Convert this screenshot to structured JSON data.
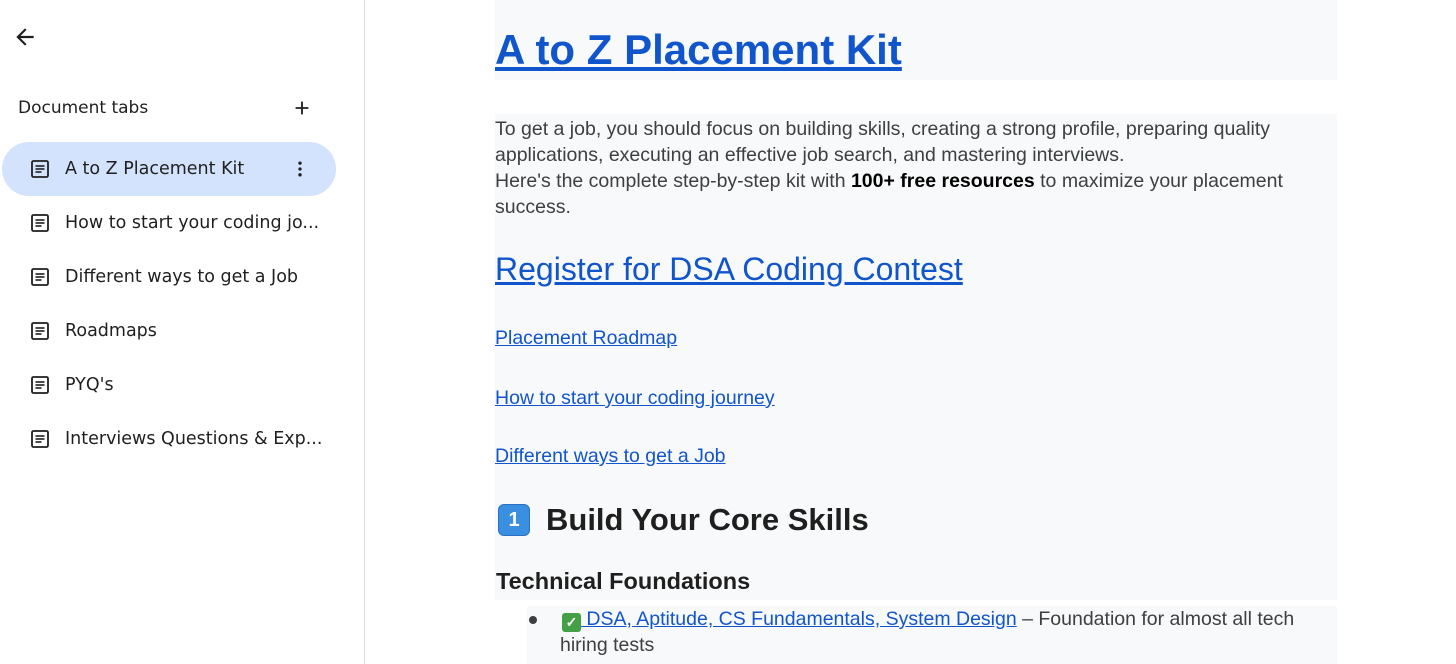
{
  "sidebar": {
    "back_icon": "arrow-left-icon",
    "header": "Document tabs",
    "add_icon": "plus-icon",
    "tabs": [
      {
        "label": "A to Z Placement Kit",
        "active": true
      },
      {
        "label": "How to start your coding jo..."
      },
      {
        "label": "Different ways to get a Job"
      },
      {
        "label": "Roadmaps"
      },
      {
        "label": "PYQ's"
      },
      {
        "label": "Interviews Questions & Exp..."
      }
    ]
  },
  "doc": {
    "title": "A to Z Placement Kit",
    "intro_line1": "To get a job, you should focus on building skills, creating a strong profile, preparing quality applications, executing an effective job search, and mastering interviews.",
    "intro_line2_pre": "Here's the complete step-by-step kit with ",
    "intro_line2_bold": "100+ free resources",
    "intro_line2_post": " to maximize your placement success.",
    "contest_link": "Register for DSA Coding Contest",
    "links": [
      "Placement Roadmap",
      "How to start your coding journey",
      "Different ways to get a Job"
    ],
    "section_number": "1",
    "section_heading": "Build Your Core Skills",
    "subheading": "Technical Foundations",
    "bullet_link": " DSA, Aptitude, CS Fundamentals, System Design",
    "bullet_text": " – Foundation for almost all tech hiring tests"
  },
  "colors": {
    "link": "#1155cc",
    "active_tab": "#d3e3fd",
    "band": "#f8f9fa"
  }
}
